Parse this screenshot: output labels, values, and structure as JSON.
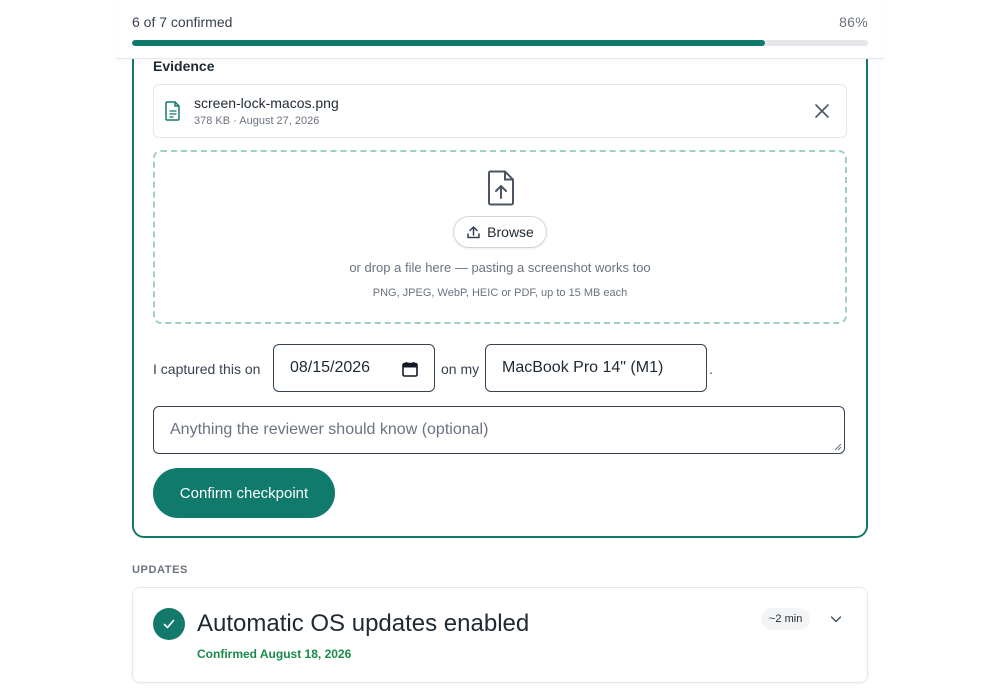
{
  "progress": {
    "count_label": "6 of 7 confirmed",
    "percent_label": "86%",
    "fraction": 0.86
  },
  "evidence": {
    "title": "Evidence",
    "file": {
      "name": "screen-lock-macos.png",
      "meta": "378 KB · August 27, 2026",
      "icon": "document-icon",
      "remove_icon": "close-icon"
    },
    "dropzone": {
      "icon": "file-upload-icon",
      "browse_label": "Browse",
      "browse_icon": "upload-icon",
      "hint": "or drop a file here — pasting a screenshot works too",
      "formats": "PNG, JPEG, WebP, HEIC or PDF, up to 15 MB each"
    }
  },
  "capture": {
    "prefix": "I captured this on",
    "date_value": "08/15/2026",
    "date_icon": "calendar-icon",
    "middle": "on my",
    "device_value": "MacBook Pro 14\" (M1)",
    "suffix": "."
  },
  "notes": {
    "placeholder": "Anything the reviewer should know (optional)"
  },
  "confirm_label": "Confirm checkpoint",
  "updates": {
    "section_label": "UPDATES",
    "items": [
      {
        "title": "Automatic OS updates enabled",
        "status": "Confirmed August 18, 2026",
        "duration": "~2 min",
        "status_icon": "check-icon",
        "expand_icon": "chevron-down-icon"
      }
    ]
  },
  "colors": {
    "accent": "#107a6c",
    "success_text": "#1a8a4a",
    "dropzone_border": "#9fcfc3"
  }
}
